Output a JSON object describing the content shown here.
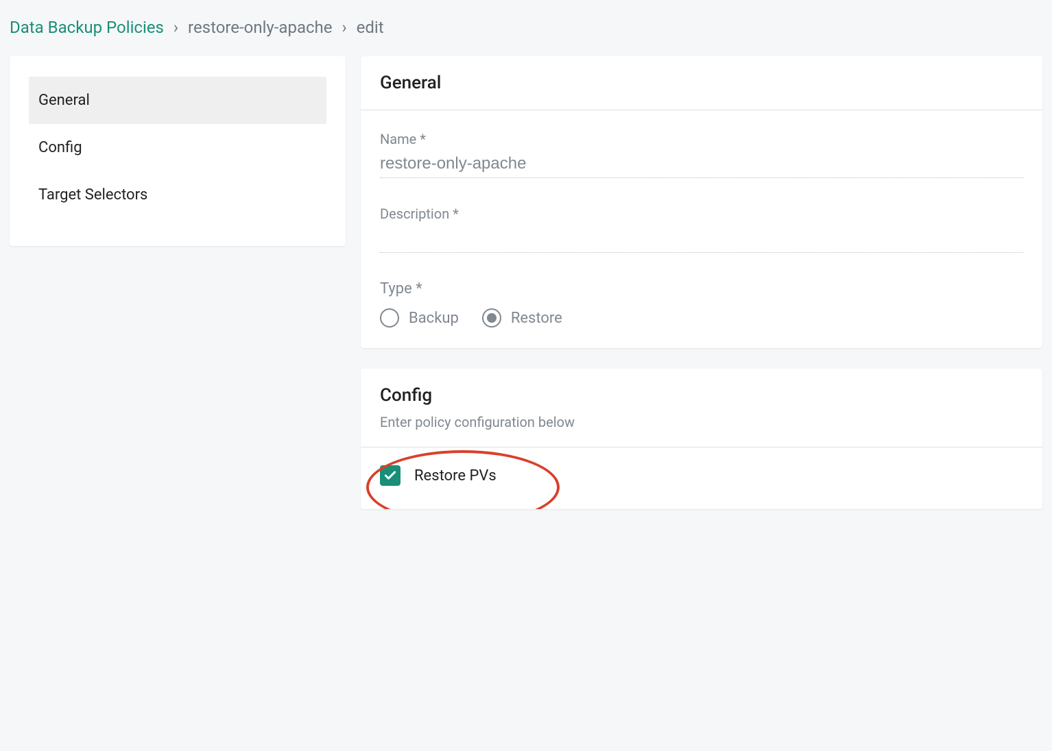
{
  "breadcrumb": {
    "root": "Data Backup Policies",
    "sep": "›",
    "item": "restore-only-apache",
    "leaf": "edit"
  },
  "sidebar": {
    "items": [
      {
        "label": "General",
        "active": true
      },
      {
        "label": "Config",
        "active": false
      },
      {
        "label": "Target Selectors",
        "active": false
      }
    ]
  },
  "general": {
    "title": "General",
    "name_label": "Name *",
    "name_value": "restore-only-apache",
    "description_label": "Description *",
    "description_value": "",
    "type_label": "Type *",
    "type_options": [
      {
        "label": "Backup",
        "selected": false
      },
      {
        "label": "Restore",
        "selected": true
      }
    ]
  },
  "config": {
    "title": "Config",
    "subtitle": "Enter policy configuration below",
    "restore_pvs_label": "Restore PVs",
    "restore_pvs_checked": true
  }
}
